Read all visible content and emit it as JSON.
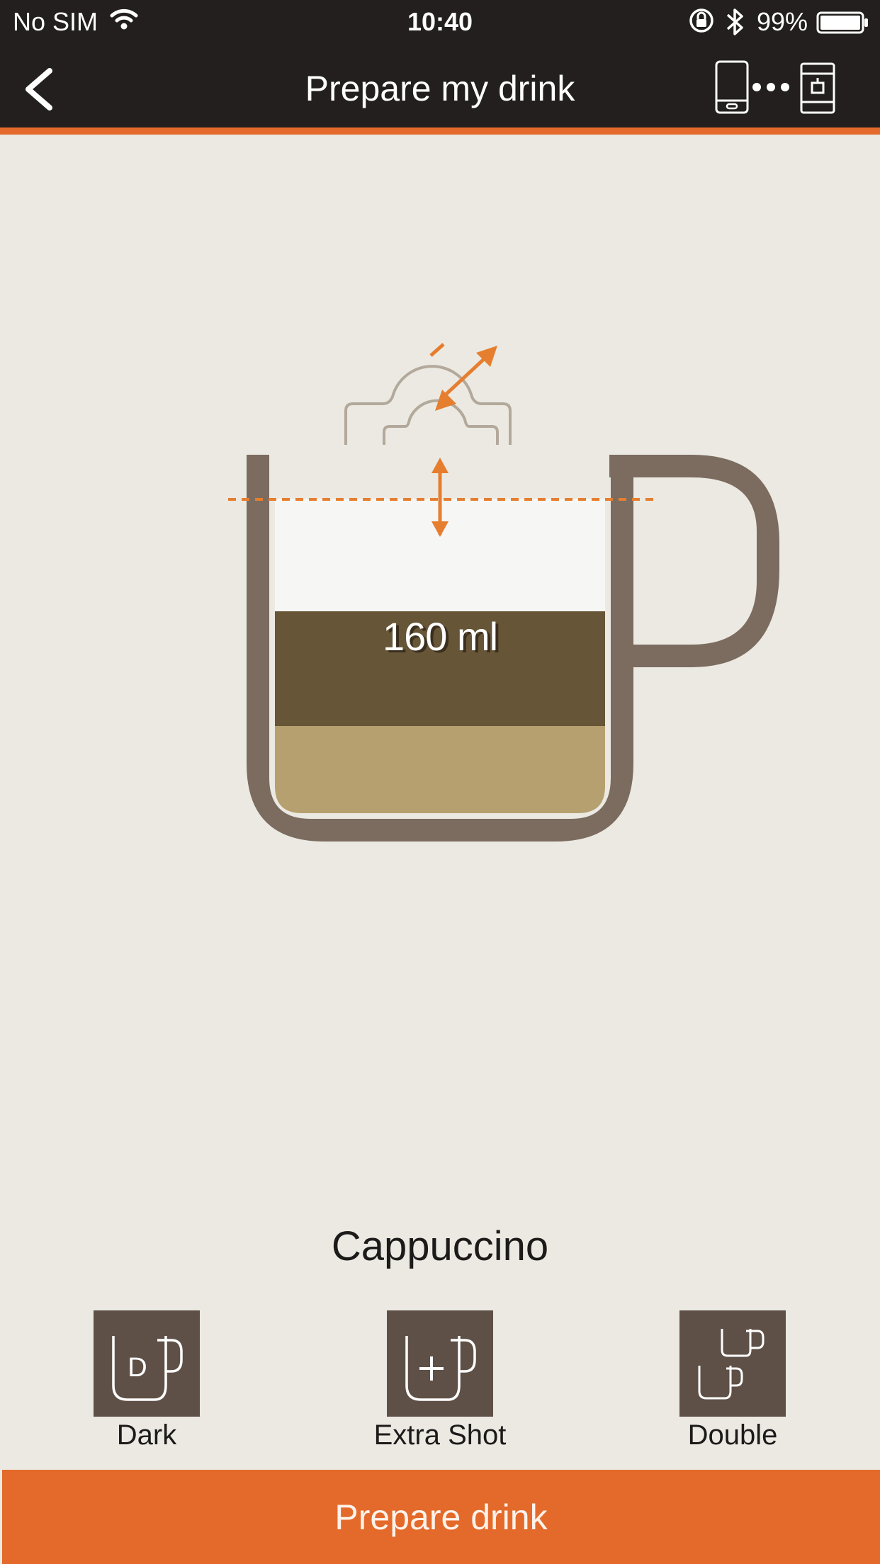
{
  "status_bar": {
    "carrier": "No SIM",
    "time": "10:40",
    "battery": "99%",
    "icons": [
      "wifi-icon",
      "rotation-lock-icon",
      "bluetooth-icon",
      "battery-icon"
    ]
  },
  "nav": {
    "title": "Prepare my drink",
    "back_icon": "chevron-left-icon",
    "connection_icon": "phone-to-machine-connection-icon"
  },
  "cup": {
    "volume": "160 ml",
    "layers": [
      "foam",
      "coffee",
      "milk"
    ],
    "colors": {
      "cup": "#7b6c5f",
      "foam": "#f6f6f4",
      "coffee": "#665536",
      "milk": "#b6a06f",
      "accent": "#e67e2f"
    }
  },
  "drink": {
    "name": "Cappuccino"
  },
  "options": [
    {
      "label": "Dark",
      "icon": "cup-dark-icon"
    },
    {
      "label": "Extra Shot",
      "icon": "cup-extra-shot-icon"
    },
    {
      "label": "Double",
      "icon": "double-cup-icon"
    }
  ],
  "prepare_button": {
    "label": "Prepare drink"
  },
  "theme": {
    "accent": "#e46a2b",
    "bar": "#221f1e",
    "background": "#ebe9e2",
    "tile": "#5f5047"
  }
}
